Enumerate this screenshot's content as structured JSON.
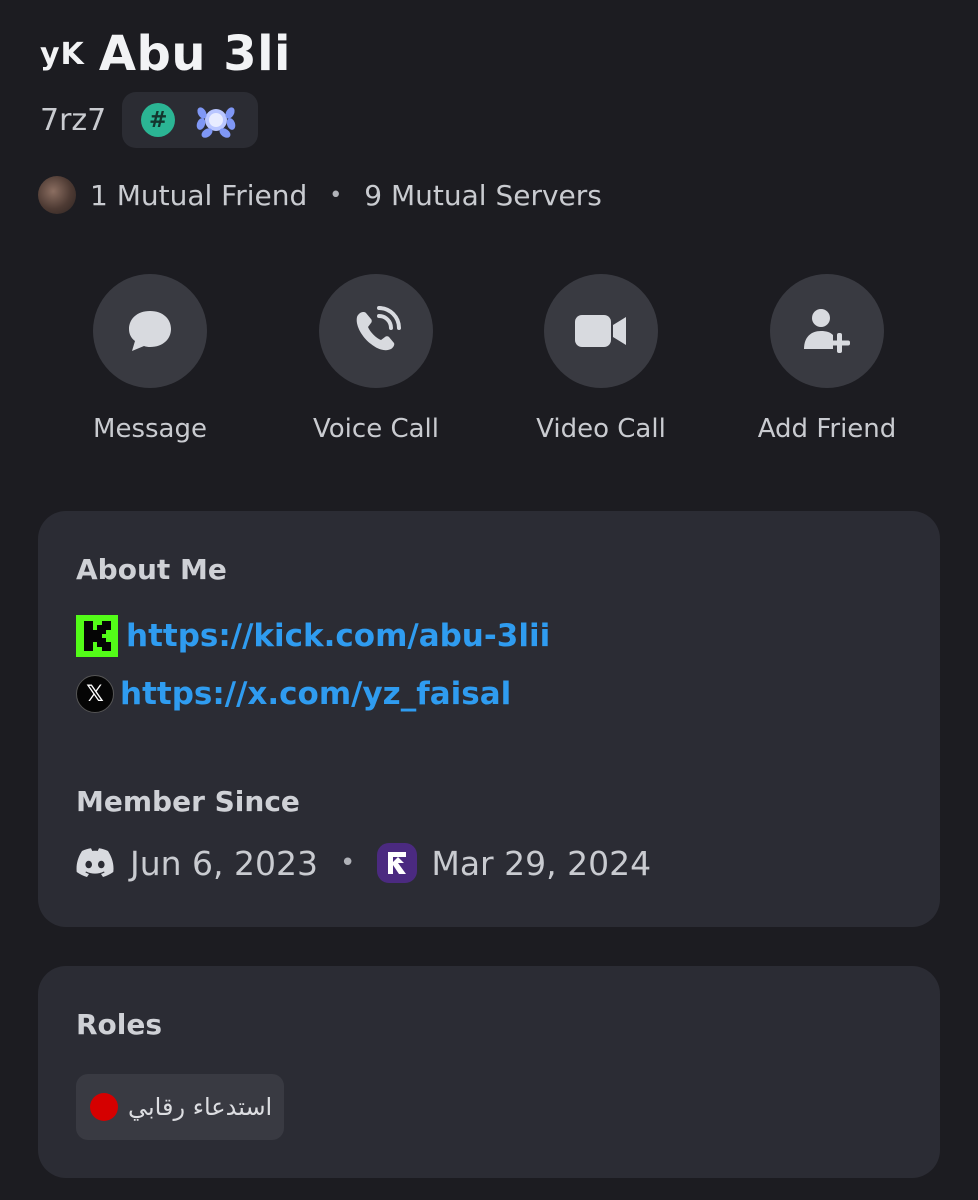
{
  "profile": {
    "name_prefix": "yK",
    "display_name": "Abu 3li",
    "username": "7rz7",
    "badges": [
      {
        "icon": "hashtag-badge-icon",
        "text": "#",
        "color": "#2bb594"
      },
      {
        "icon": "laurel-badge-icon",
        "color": "#9fb3ff"
      }
    ]
  },
  "mutuals": {
    "friends": "1 Mutual Friend",
    "separator": "•",
    "servers": "9 Mutual Servers"
  },
  "actions": [
    {
      "label": "Message",
      "icon": "message-bubble-icon"
    },
    {
      "label": "Voice Call",
      "icon": "phone-call-icon"
    },
    {
      "label": "Video Call",
      "icon": "video-camera-icon"
    },
    {
      "label": "Add Friend",
      "icon": "add-friend-icon"
    }
  ],
  "about": {
    "title": "About Me",
    "links": [
      {
        "icon": "kick-icon",
        "url": "https://kick.com/abu-3lii",
        "color": "#2f9cf0"
      },
      {
        "icon": "x-twitter-icon",
        "url": "https://x.com/yz_faisal",
        "color": "#2f9cf0"
      }
    ]
  },
  "member_since": {
    "title": "Member Since",
    "discord_date": "Jun 6, 2023",
    "separator": "•",
    "server_date": "Mar 29, 2024"
  },
  "roles": {
    "title": "Roles",
    "items": [
      {
        "name": "استدعاء رقابي",
        "color": "#d50000"
      }
    ]
  },
  "colors": {
    "background": "#1c1c21",
    "card": "#2b2c34",
    "link": "#2f9cf0",
    "action_circle": "#393a41"
  }
}
